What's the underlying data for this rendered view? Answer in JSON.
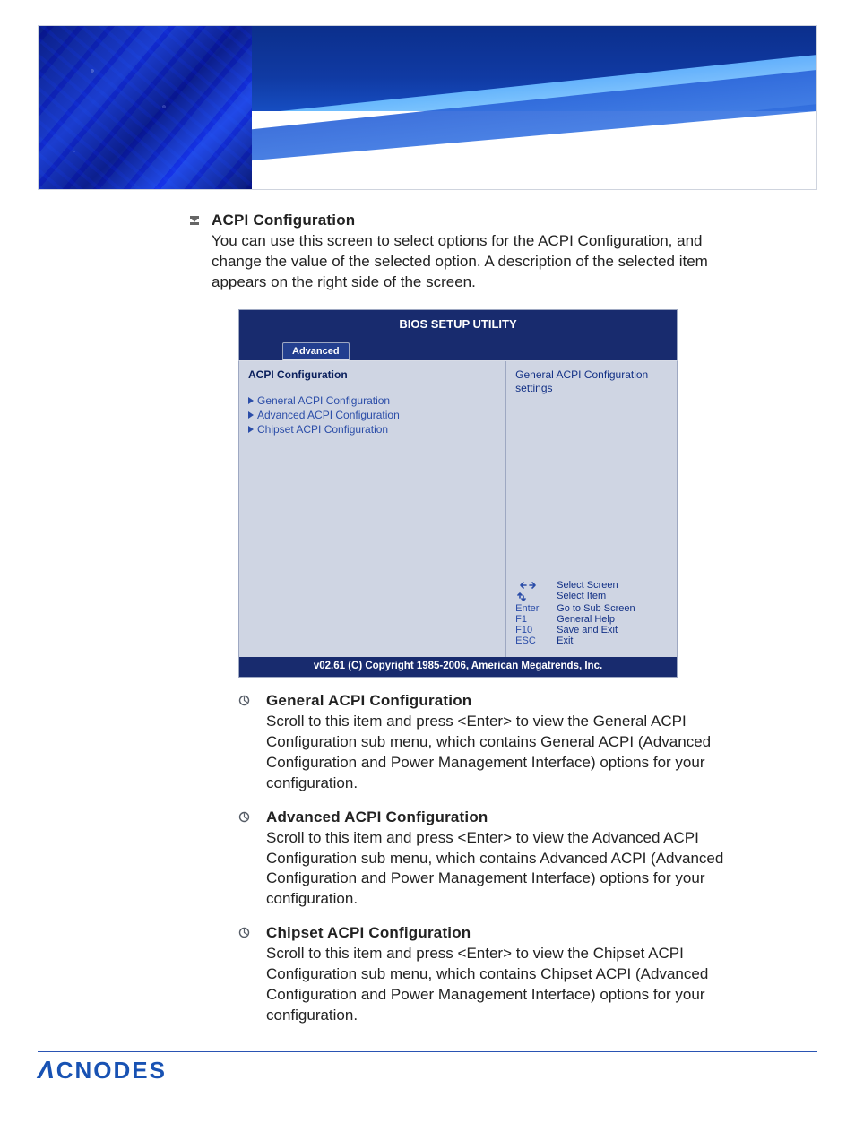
{
  "section": {
    "title": "ACPI Configuration",
    "desc": "You can use this screen to select options for the ACPI Configuration, and change the value of the selected option. A description of the selected item appears on the right side of the screen."
  },
  "bios": {
    "title": "BIOS SETUP UTILITY",
    "tab": "Advanced",
    "heading": "ACPI Configuration",
    "items": [
      "General ACPI Configuration",
      "Advanced ACPI Configuration",
      "Chipset ACPI Configuration"
    ],
    "side_help": "General ACPI Configuration settings",
    "keys": [
      {
        "key": "←→",
        "label": "Select Screen"
      },
      {
        "key": "↑↓",
        "label": "Select Item"
      },
      {
        "key": "Enter",
        "label": "Go to Sub Screen"
      },
      {
        "key": "F1",
        "label": "General Help"
      },
      {
        "key": "F10",
        "label": "Save and Exit"
      },
      {
        "key": "ESC",
        "label": "Exit"
      }
    ],
    "footer": "v02.61 (C) Copyright 1985-2006, American Megatrends, Inc."
  },
  "subs": [
    {
      "title": "General ACPI Configuration",
      "desc": "Scroll to this item and press <Enter> to view the General ACPI Configuration sub menu, which contains General ACPI (Advanced Configuration and Power Management Interface) options for your configuration."
    },
    {
      "title": "Advanced ACPI Configuration",
      "desc": "Scroll to this item and press <Enter> to view the Advanced ACPI Configuration sub menu, which contains Advanced ACPI (Advanced Configuration and Power Management Interface) options for your configuration."
    },
    {
      "title": "Chipset ACPI Configuration",
      "desc": "Scroll to this item and press <Enter> to view the Chipset ACPI Configuration sub menu, which contains Chipset ACPI (Advanced Configuration and Power Management Interface) options for your configuration."
    }
  ],
  "footer_logo": "CNODES"
}
